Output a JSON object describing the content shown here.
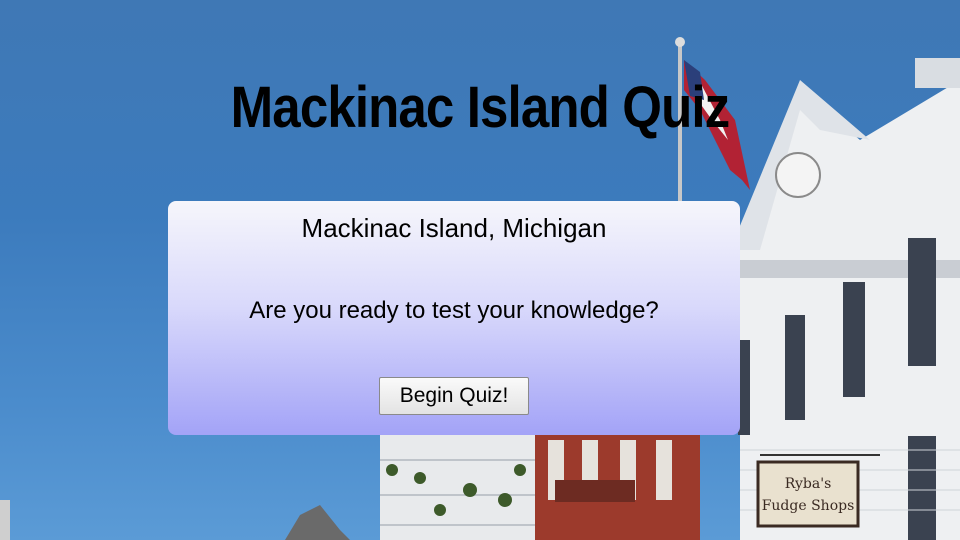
{
  "page": {
    "title": "Mackinac Island Quiz"
  },
  "card": {
    "subtitle": "Mackinac Island, Michigan",
    "question": "Are you ready to test your knowledge?",
    "begin_button_label": "Begin Quiz!"
  },
  "background": {
    "sign_text": "Ryba's\nFudge Shops"
  },
  "colors": {
    "sky": "#3f78b5",
    "card_top": "#f6f6fb",
    "card_bottom": "#a3a3f7",
    "title_text": "#000000"
  }
}
